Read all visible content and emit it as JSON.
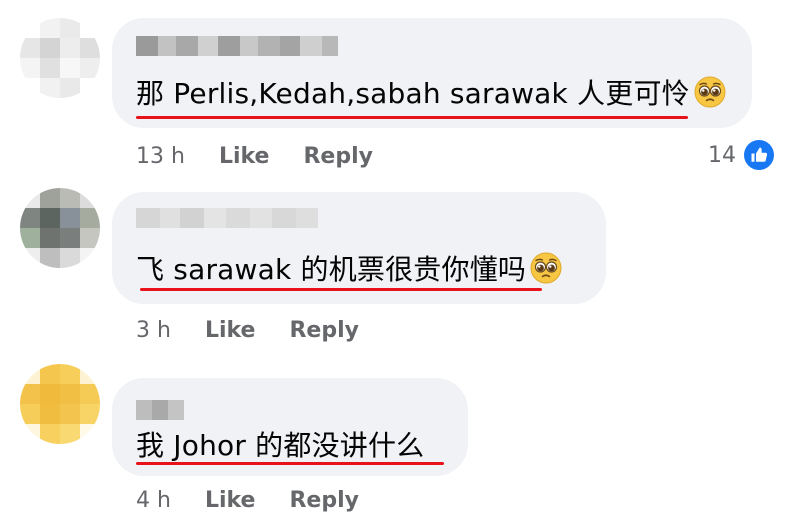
{
  "comments": [
    {
      "text": "那 Perlis,Kedah,sabah sarawak 人更可怜",
      "emoji": "pleading-face",
      "time": "13 h",
      "like_label": "Like",
      "reply_label": "Reply",
      "reaction_count": "14",
      "reaction_type": "like"
    },
    {
      "text": "飞 sarawak 的机票很贵你懂吗",
      "emoji": "pleading-face",
      "time": "3 h",
      "like_label": "Like",
      "reply_label": "Reply"
    },
    {
      "text": "我 Johor 的都没讲什么",
      "time": "4 h",
      "like_label": "Like",
      "reply_label": "Reply"
    }
  ],
  "colors": {
    "bubble": "#f0f2f5",
    "underline": "#e8121b",
    "meta_text": "#65676b",
    "like_blue": "#1877f2"
  }
}
